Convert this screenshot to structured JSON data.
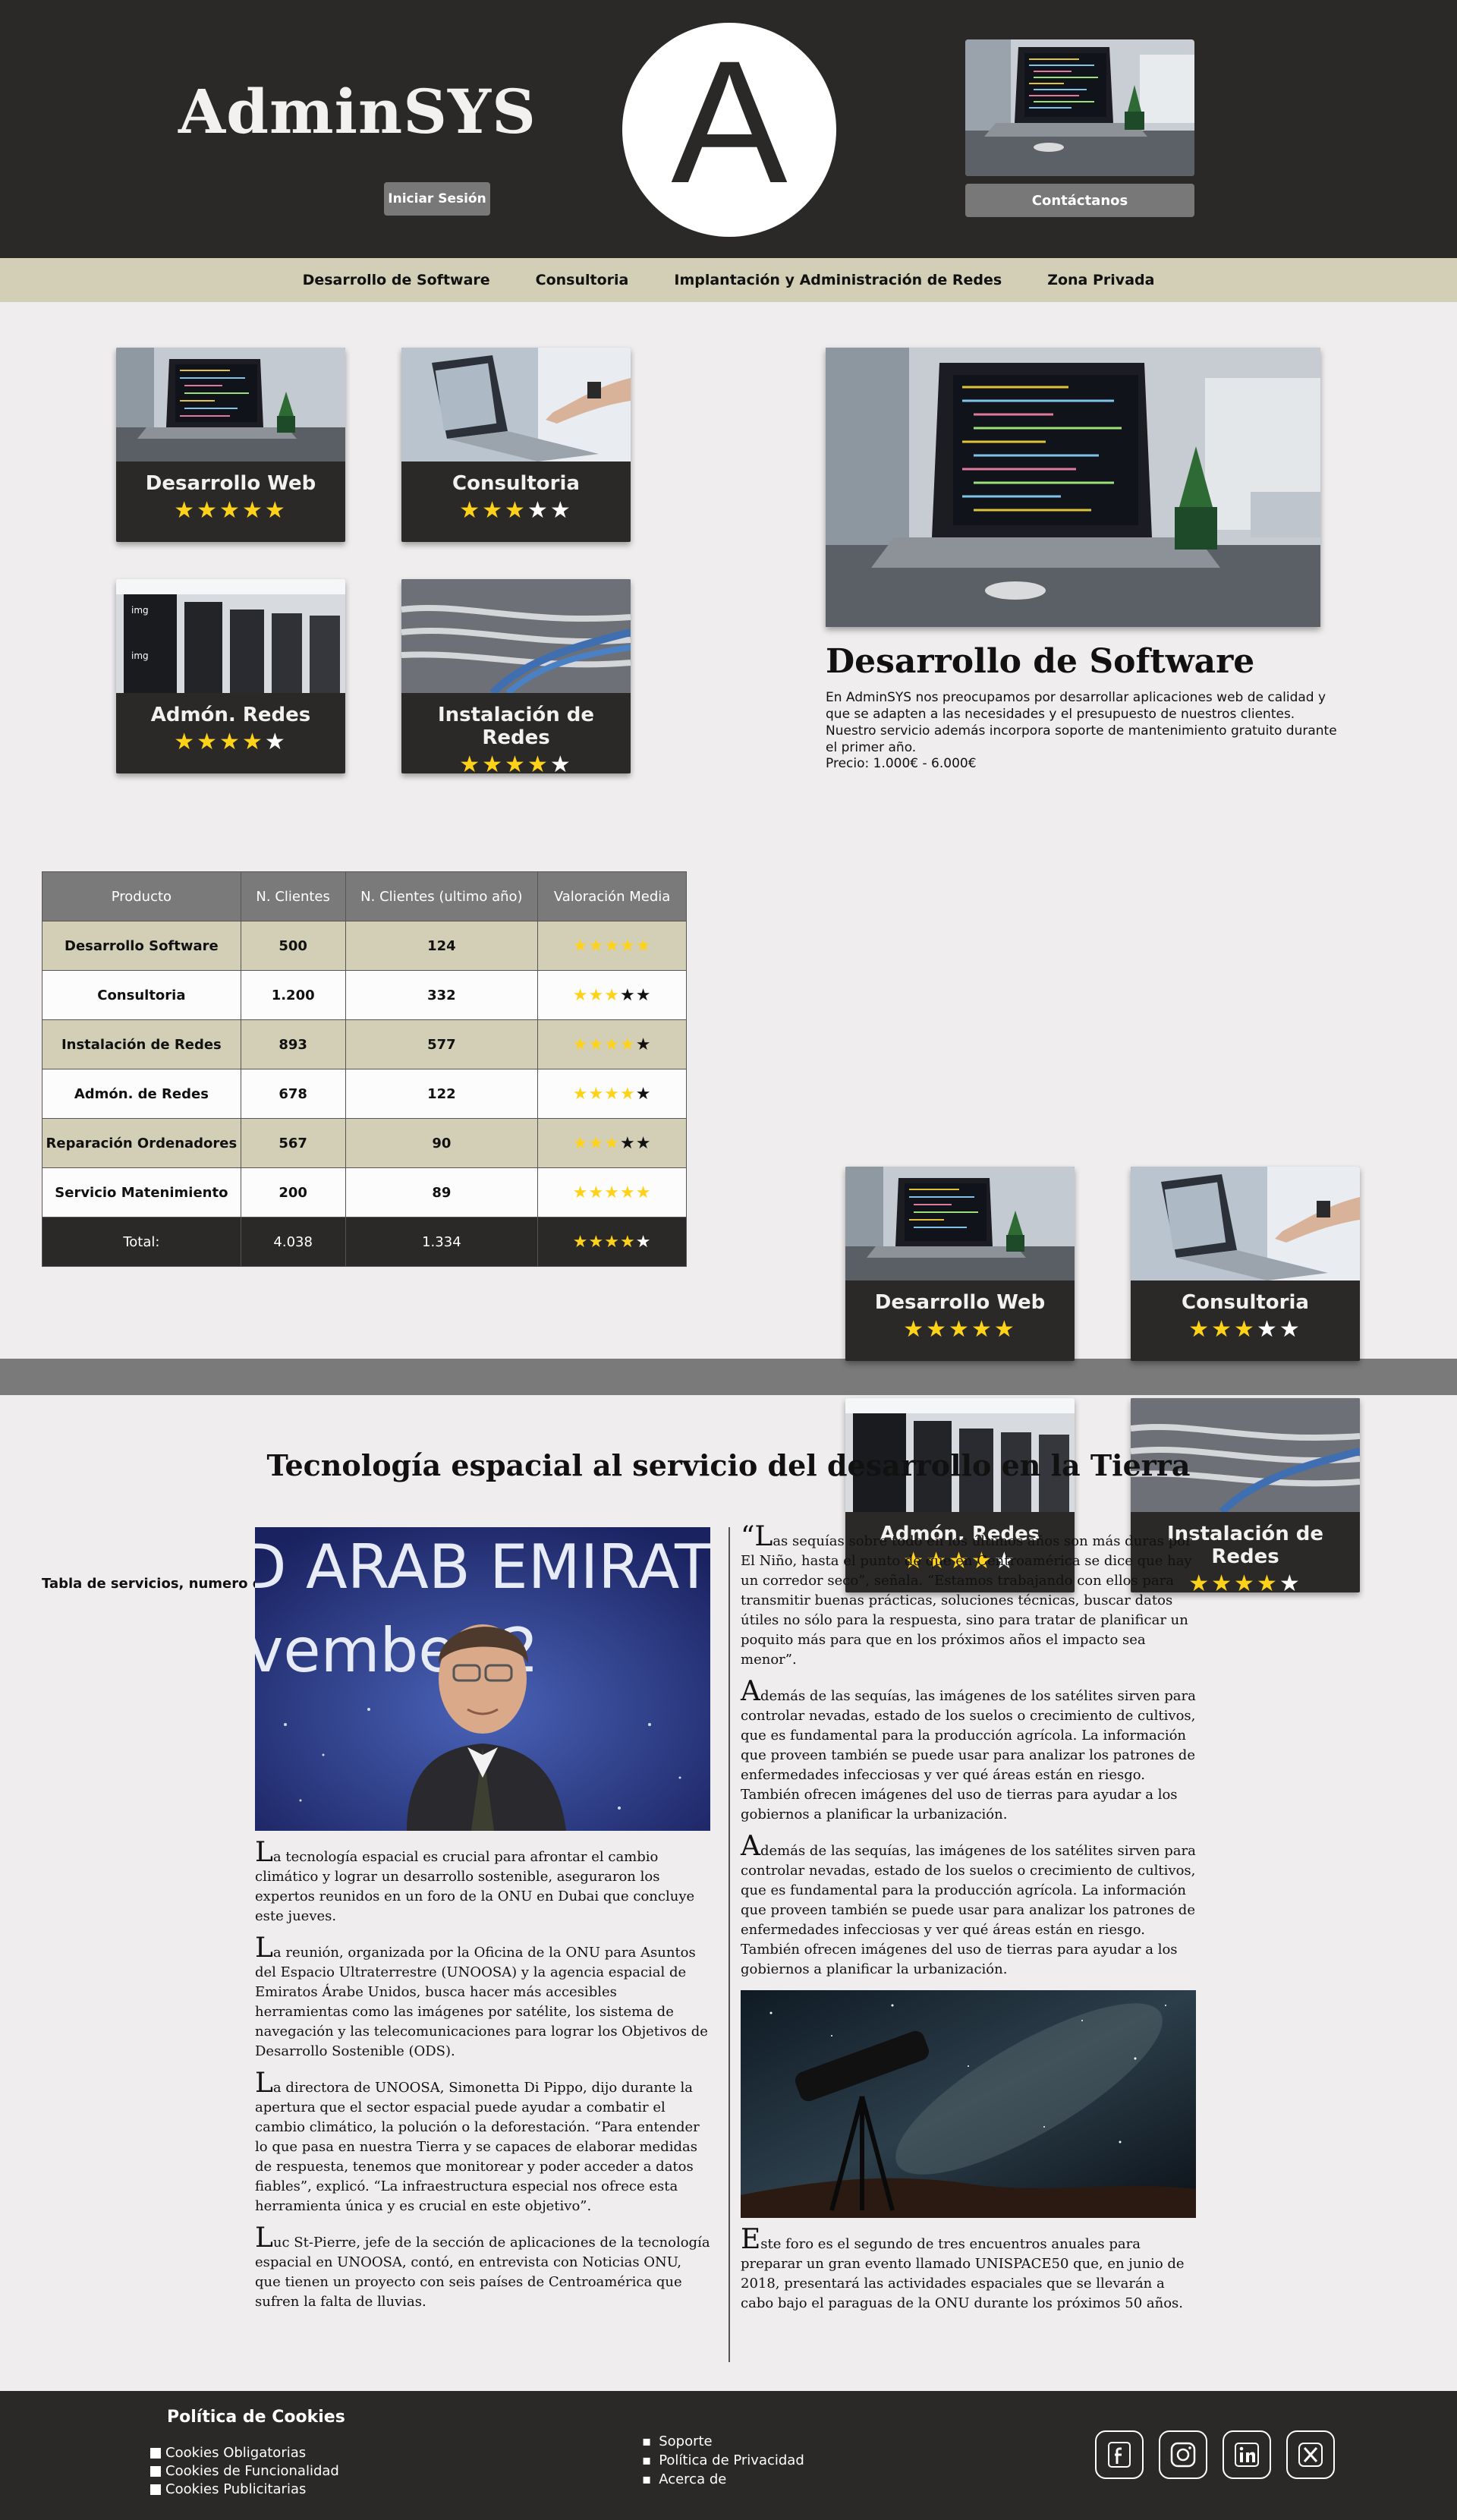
{
  "header": {
    "brand": "AdminSYS",
    "logo_letter": "A",
    "login_label": "Iniciar Sesión",
    "contact_label": "Contáctanos"
  },
  "nav": {
    "items": [
      "Desarrollo de Software",
      "Consultoria",
      "Implantación y Administración de Redes",
      "Zona Privada"
    ]
  },
  "services": [
    {
      "title": "Desarrollo Web",
      "rating": 5
    },
    {
      "title": "Consultoria",
      "rating": 3
    },
    {
      "title": "Admón. Redes",
      "rating": 4
    },
    {
      "title": "Instalación de Redes",
      "rating": 4
    }
  ],
  "feature": {
    "title": "Desarrollo de Software",
    "description": "En AdminSYS nos preocupamos por desarrollar aplicaciones web de calidad y que se adapten a las necesidades y el presupuesto de nuestros clientes. Nuestro servicio además incorpora soporte de mantenimiento gratuito durante el primer año.",
    "price": "Precio: 1.000€ - 6.000€"
  },
  "table": {
    "headers": [
      "Producto",
      "N. Clientes",
      "N. Clientes (ultimo año)",
      "Valoración Media"
    ],
    "rows": [
      {
        "product": "Desarrollo Software",
        "clients": "500",
        "last_year": "124",
        "rating": 5
      },
      {
        "product": "Consultoria",
        "clients": "1.200",
        "last_year": "332",
        "rating": 3
      },
      {
        "product": "Instalación de Redes",
        "clients": "893",
        "last_year": "577",
        "rating": 4
      },
      {
        "product": "Admón. de Redes",
        "clients": "678",
        "last_year": "122",
        "rating": 4
      },
      {
        "product": "Reparación Ordenadores",
        "clients": "567",
        "last_year": "90",
        "rating": 3
      },
      {
        "product": "Servicio Matenimiento",
        "clients": "200",
        "last_year": "89",
        "rating": 5
      }
    ],
    "total": {
      "product": "Total:",
      "clients": "4.038",
      "last_year": "1.334",
      "rating": 4
    },
    "caption": "Tabla de servicios, numero de clientes y valoraciones"
  },
  "article": {
    "title": "Tecnología espacial al servicio del desarrollo en la Tierra",
    "left_paragraphs": [
      "La tecnología espacial es crucial para afrontar el cambio climático y lograr un desarrollo sostenible, aseguraron los expertos reunidos en un foro de la ONU en Dubai que concluye este jueves.",
      "La reunión, organizada por la Oficina de la ONU para Asuntos del Espacio Ultraterrestre (UNOOSA) y la agencia espacial de Emiratos Árabe Unidos, busca hacer más accesibles herramientas como las imágenes por satélite, los sistema de navegación y las telecomunicaciones para lograr los Objetivos de Desarrollo Sostenible (ODS).",
      "La directora de UNOOSA, Simonetta Di Pippo, dijo durante la apertura que el sector espacial puede ayudar a combatir el cambio climático, la polución o la deforestación. “Para entender lo que pasa en nuestra Tierra y se capaces de elaborar medidas de respuesta, tenemos que monitorear y poder acceder a datos fiables”, explicó. “La infraestructura especial nos ofrece esta herramienta única y es crucial en este objetivo”.",
      "Luc St-Pierre, jefe de la sección de aplicaciones de la tecnología espacial en UNOOSA, contó, en entrevista con Noticias ONU, que tienen un proyecto con seis países de Centroamérica que sufren la falta de lluvias."
    ],
    "right_paragraphs": [
      "“Las sequías sobre todo en los últimos años son más duras por El Niño, hasta el punto de que en Centroamérica se dice que hay un corredor seco”, señala. “Estamos trabajando con ellos para transmitir buenas prácticas, soluciones técnicas, buscar datos útiles no sólo para la respuesta, sino para tratar de planificar un poquito más para que en los próximos años el impacto sea menor”.",
      "Además de las sequías, las imágenes de los satélites sirven para controlar nevadas, estado de los suelos o crecimiento de cultivos, que es fundamental para la producción agrícola. La información que proveen también se puede usar para analizar los patrones de enfermedades infecciosas y ver qué áreas están en riesgo. También ofrecen imágenes del uso de tierras para ayudar a los gobiernos a planificar la urbanización.",
      "Además de las sequías, las imágenes de los satélites sirven para controlar nevadas, estado de los suelos o crecimiento de cultivos, que es fundamental para la producción agrícola. La información que proveen también se puede usar para analizar los patrones de enfermedades infecciosas y ver qué áreas están en riesgo. También ofrecen imágenes del uso de tierras para ayudar a los gobiernos a planificar la urbanización."
    ],
    "final_paragraph": "Este foro es el segundo de tres encuentros anuales para preparar un gran evento llamado UNISPACE50 que, en junio de 2018, presentará las actividades espaciales que se llevarán a cabo bajo el paraguas de la ONU durante los próximos 50 años.",
    "banner_text": "D ARAB EMIRATES",
    "banner_text2": "vember 2"
  },
  "footer": {
    "cookies_title": "Política de Cookies",
    "cookies": [
      "Cookies Obligatorias",
      "Cookies de Funcionalidad",
      "Cookies Publicitarias"
    ],
    "links": [
      "Soporte",
      "Política de Privacidad",
      "Acerca de"
    ],
    "social": [
      "facebook-icon",
      "instagram-icon",
      "linkedin-icon",
      "x-icon"
    ]
  },
  "colors": {
    "dark": "#2a2928",
    "nav_bg": "#d3cfb6",
    "button_grey": "#787878",
    "star": "#ffd21a"
  }
}
